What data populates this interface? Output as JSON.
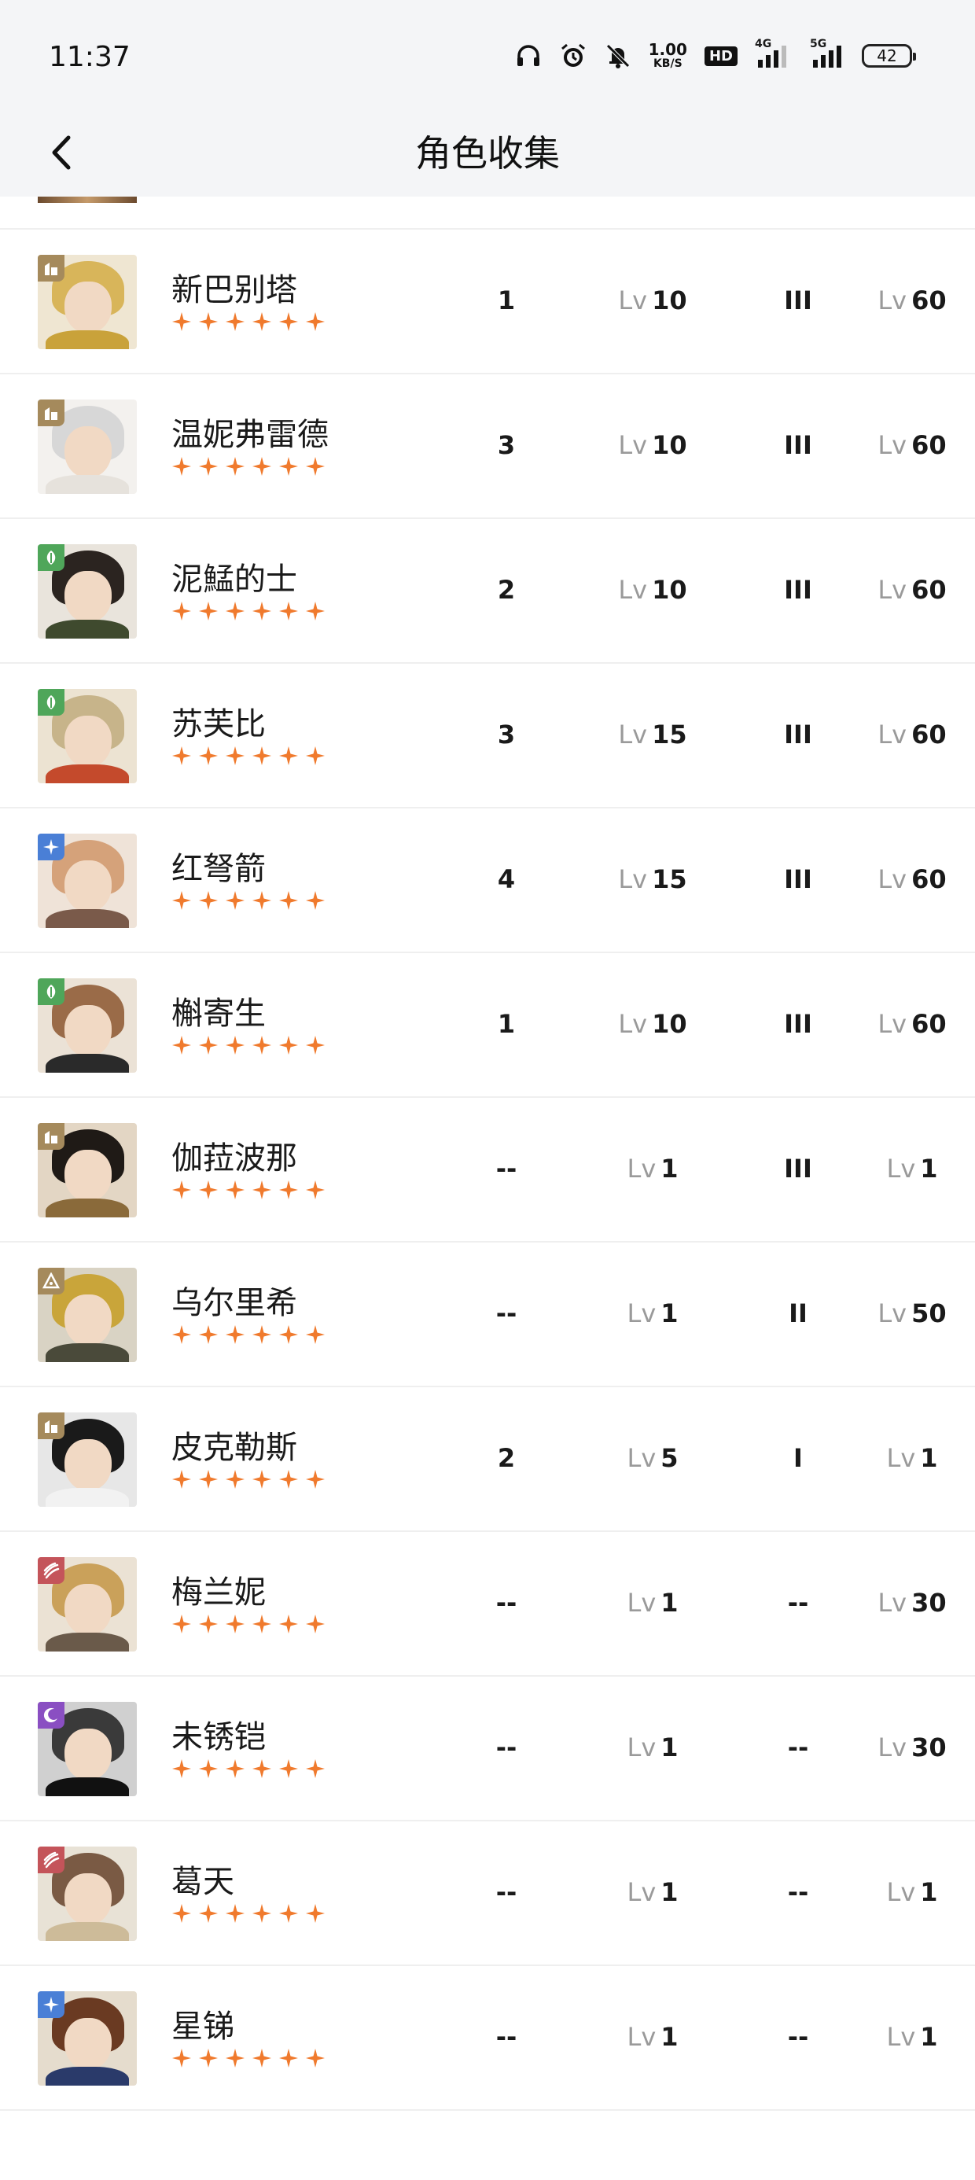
{
  "status_bar": {
    "time": "11:37",
    "net_speed_value": "1.00",
    "net_speed_unit": "KB/S",
    "hd_label": "HD",
    "net_4g": "4G",
    "net_5g": "5G",
    "battery": "42"
  },
  "header": {
    "title": "角色收集",
    "back_icon": "chevron-left-icon"
  },
  "colors": {
    "star": "#f07a2d",
    "level_prefix": "#9a9a9a",
    "badge_brown": "#a58a5c",
    "badge_green": "#4fa65a",
    "badge_blue": "#4a7fd6",
    "badge_red": "#c4545a",
    "badge_purple": "#8a4fc2"
  },
  "characters": [
    {
      "name": "新巴别塔",
      "stars": 6,
      "col1": "1",
      "col2_prefix": "Lv",
      "col2": "10",
      "col3": "III",
      "col4_prefix": "Lv",
      "col4": "60",
      "badge": "building-icon"
    },
    {
      "name": "温妮弗雷德",
      "stars": 6,
      "col1": "3",
      "col2_prefix": "Lv",
      "col2": "10",
      "col3": "III",
      "col4_prefix": "Lv",
      "col4": "60",
      "badge": "building-icon"
    },
    {
      "name": "泥鯭的士",
      "stars": 6,
      "col1": "2",
      "col2_prefix": "Lv",
      "col2": "10",
      "col3": "III",
      "col4_prefix": "Lv",
      "col4": "60",
      "badge": "leaf-icon"
    },
    {
      "name": "苏芙比",
      "stars": 6,
      "col1": "3",
      "col2_prefix": "Lv",
      "col2": "15",
      "col3": "III",
      "col4_prefix": "Lv",
      "col4": "60",
      "badge": "leaf-icon"
    },
    {
      "name": "红弩箭",
      "stars": 6,
      "col1": "4",
      "col2_prefix": "Lv",
      "col2": "15",
      "col3": "III",
      "col4_prefix": "Lv",
      "col4": "60",
      "badge": "star-burst-icon"
    },
    {
      "name": "槲寄生",
      "stars": 6,
      "col1": "1",
      "col2_prefix": "Lv",
      "col2": "10",
      "col3": "III",
      "col4_prefix": "Lv",
      "col4": "60",
      "badge": "leaf-icon"
    },
    {
      "name": "伽菈波那",
      "stars": 6,
      "col1": "--",
      "col2_prefix": "Lv",
      "col2": "1",
      "col3": "III",
      "col4_prefix": "Lv",
      "col4": "1",
      "badge": "building-icon"
    },
    {
      "name": "乌尔里希",
      "stars": 6,
      "col1": "--",
      "col2_prefix": "Lv",
      "col2": "1",
      "col3": "II",
      "col4_prefix": "Lv",
      "col4": "50",
      "badge": "triangle-icon"
    },
    {
      "name": "皮克勒斯",
      "stars": 6,
      "col1": "2",
      "col2_prefix": "Lv",
      "col2": "5",
      "col3": "I",
      "col4_prefix": "Lv",
      "col4": "1",
      "badge": "building-icon"
    },
    {
      "name": "梅兰妮",
      "stars": 6,
      "col1": "--",
      "col2_prefix": "Lv",
      "col2": "1",
      "col3": "--",
      "col4_prefix": "Lv",
      "col4": "30",
      "badge": "claw-icon"
    },
    {
      "name": "未锈铠",
      "stars": 6,
      "col1": "--",
      "col2_prefix": "Lv",
      "col2": "1",
      "col3": "--",
      "col4_prefix": "Lv",
      "col4": "30",
      "badge": "moon-icon"
    },
    {
      "name": "葛天",
      "stars": 6,
      "col1": "--",
      "col2_prefix": "Lv",
      "col2": "1",
      "col3": "--",
      "col4_prefix": "Lv",
      "col4": "1",
      "badge": "claw-icon"
    },
    {
      "name": "星锑",
      "stars": 6,
      "col1": "--",
      "col2_prefix": "Lv",
      "col2": "1",
      "col3": "--",
      "col4_prefix": "Lv",
      "col4": "1",
      "badge": "star-burst-icon"
    }
  ]
}
